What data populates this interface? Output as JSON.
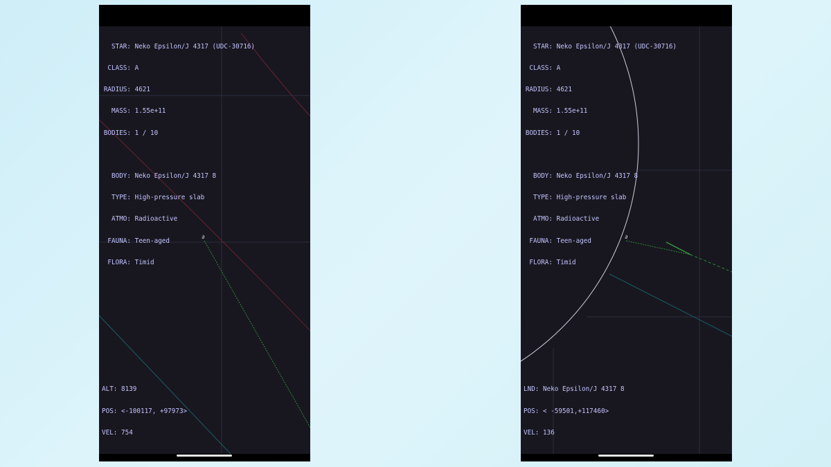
{
  "phones": [
    {
      "star": {
        "label_star": "STAR:",
        "star": "Neko Epsilon/J 4317 (UDC-30716)",
        "label_class": "CLASS:",
        "class": "A",
        "label_radius": "RADIUS:",
        "radius": "4621",
        "label_mass": "MASS:",
        "mass": "1.55e+11",
        "label_bodies": "BODIES:",
        "bodies": "1 / 10"
      },
      "body": {
        "label_body": "BODY:",
        "body": "Neko Epsilon/J 4317 8",
        "label_type": "TYPE:",
        "type": "High-pressure slab",
        "label_atmo": "ATMO:",
        "atmo": "Radioactive",
        "label_fauna": "FAUNA:",
        "fauna": "Teen-aged",
        "label_flora": "FLORA:",
        "flora": "Timid"
      },
      "telemetry": {
        "line1_label": "ALT:",
        "line1_value": "8139",
        "pos_label": "POS:",
        "pos_value": "<-100117, +97973>",
        "vel_label": "VEL:",
        "vel_value": "754"
      },
      "ship_glyph": "∂"
    },
    {
      "star": {
        "label_star": "STAR:",
        "star": "Neko Epsilon/J 4317 (UDC-30716)",
        "label_class": "CLASS:",
        "class": "A",
        "label_radius": "RADIUS:",
        "radius": "4621",
        "label_mass": "MASS:",
        "mass": "1.55e+11",
        "label_bodies": "BODIES:",
        "bodies": "1 / 10"
      },
      "body": {
        "label_body": "BODY:",
        "body": "Neko Epsilon/J 4317 8",
        "label_type": "TYPE:",
        "type": "High-pressure slab",
        "label_atmo": "ATMO:",
        "atmo": "Radioactive",
        "label_fauna": "FAUNA:",
        "fauna": "Teen-aged",
        "label_flora": "FLORA:",
        "flora": "Timid"
      },
      "telemetry": {
        "line1_label": "LND:",
        "line1_value": "Neko Epsilon/J 4317 8",
        "pos_label": "POS:",
        "pos_value": "< -59501,+117460>",
        "vel_label": "VEL:",
        "vel_value": "136"
      },
      "ship_glyph": "∂"
    }
  ],
  "colors": {
    "background": "#18171f",
    "hud_text": "#c4c4ff",
    "grid": "#2a2d3f",
    "orbit_red": "#6b2230",
    "trajectory_green": "#2f8a3b",
    "trajectory_teal": "#1d5b66",
    "planet_outline": "#cfcfe0"
  }
}
